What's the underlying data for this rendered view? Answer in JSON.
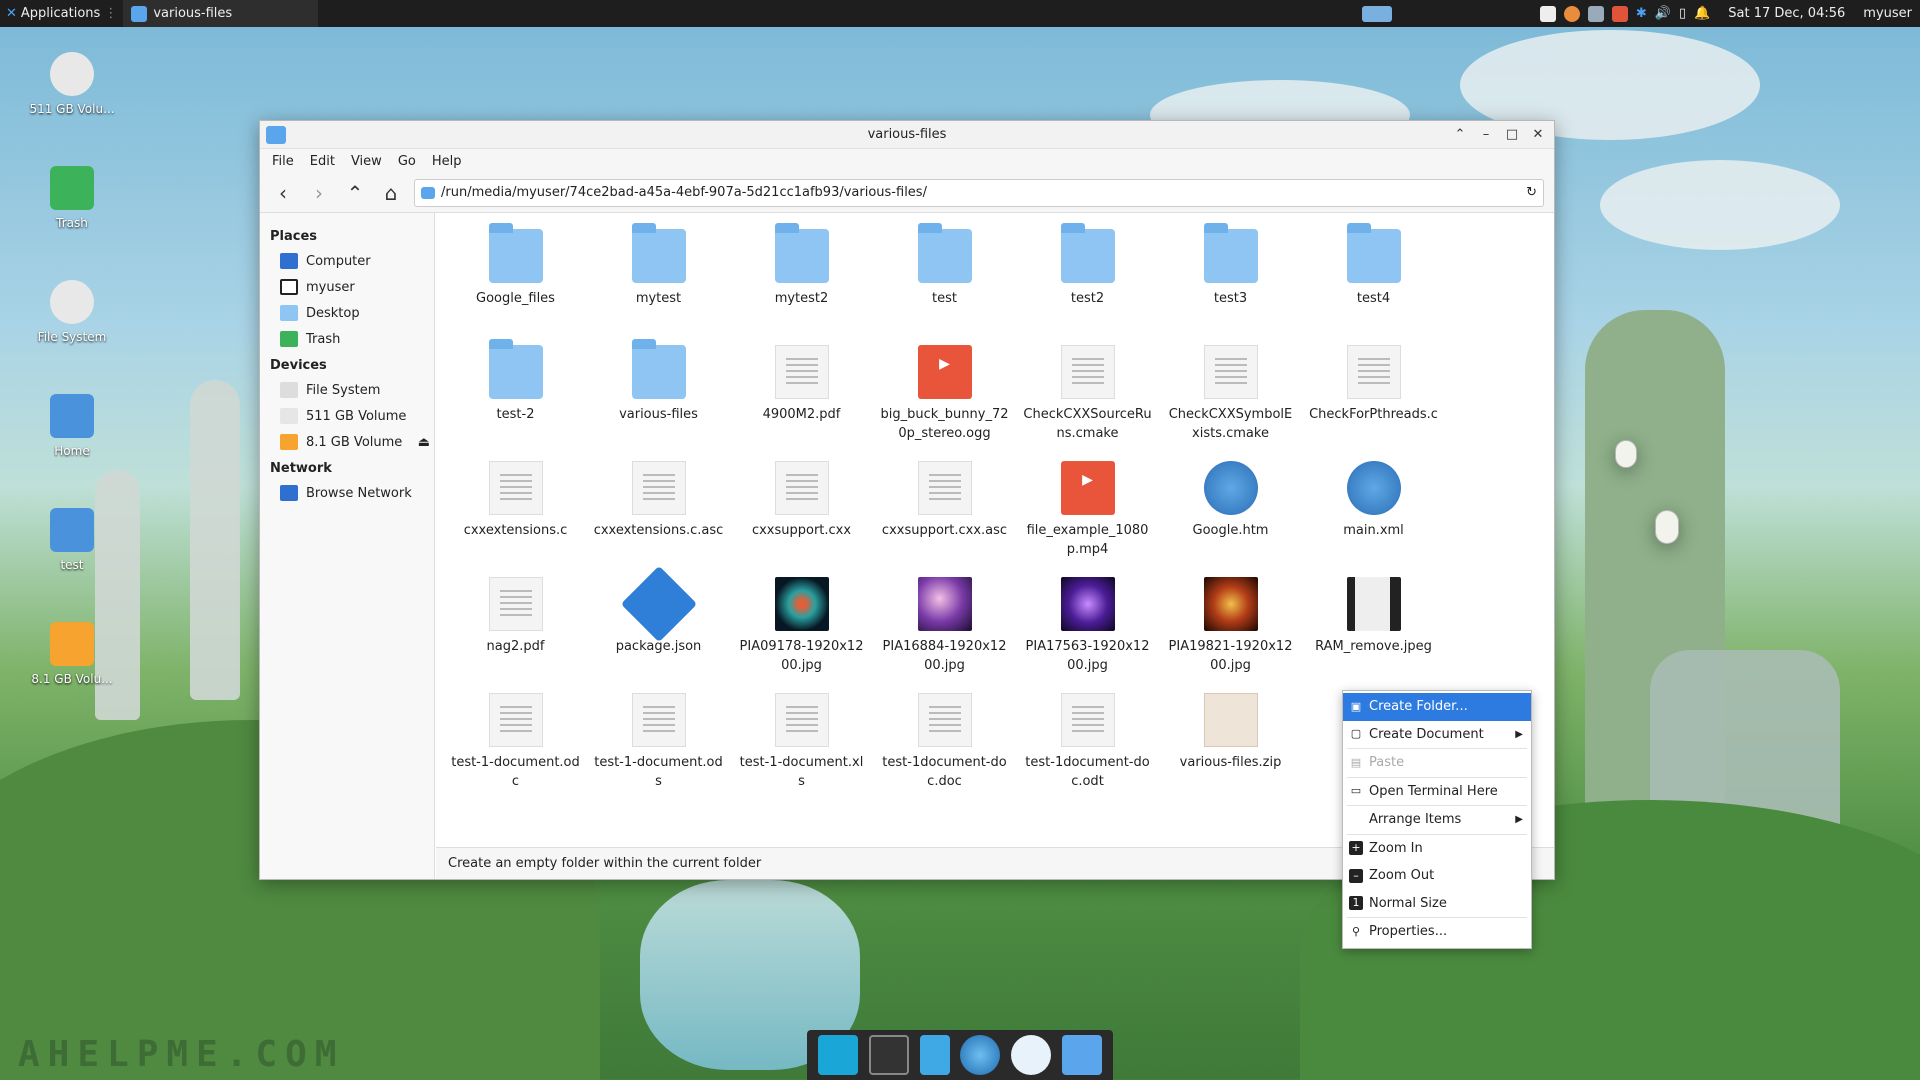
{
  "panel": {
    "applications": "Applications",
    "task_title": "various-files",
    "datetime": "Sat 17 Dec, 04:56",
    "user": "myuser"
  },
  "desktop": {
    "icons": [
      "511 GB Volu...",
      "Trash",
      "File System",
      "Home",
      "test",
      "8.1 GB Volu..."
    ],
    "watermark": "AHELPME.COM"
  },
  "window": {
    "title": "various-files",
    "path": "/run/media/myuser/74ce2bad-a45a-4ebf-907a-5d21cc1afb93/various-files/"
  },
  "menu": [
    "File",
    "Edit",
    "View",
    "Go",
    "Help"
  ],
  "sidebar": {
    "places_title": "Places",
    "places": [
      "Computer",
      "myuser",
      "Desktop",
      "Trash"
    ],
    "devices_title": "Devices",
    "devices": [
      "File System",
      "511 GB Volume",
      "8.1 GB Volume"
    ],
    "network_title": "Network",
    "network": [
      "Browse Network"
    ]
  },
  "files": [
    {
      "name": "Google_files",
      "kind": "folder"
    },
    {
      "name": "mytest",
      "kind": "folder"
    },
    {
      "name": "mytest2",
      "kind": "folder"
    },
    {
      "name": "test",
      "kind": "folder"
    },
    {
      "name": "test2",
      "kind": "folder"
    },
    {
      "name": "test3",
      "kind": "folder"
    },
    {
      "name": "test4",
      "kind": "folder"
    },
    {
      "name": "test-2",
      "kind": "folder"
    },
    {
      "name": "various-files",
      "kind": "folder"
    },
    {
      "name": "4900M2.pdf",
      "kind": "doc"
    },
    {
      "name": "big_buck_bunny_720p_stereo.ogg",
      "kind": "video"
    },
    {
      "name": "CheckCXXSourceRuns.cmake",
      "kind": "doc"
    },
    {
      "name": "CheckCXXSymbolExists.cmake",
      "kind": "doc"
    },
    {
      "name": "CheckForPthreads.c",
      "kind": "doc"
    },
    {
      "name": "cxxextensions.c",
      "kind": "doc"
    },
    {
      "name": "cxxextensions.c.asc",
      "kind": "doc"
    },
    {
      "name": "cxxsupport.cxx",
      "kind": "doc"
    },
    {
      "name": "cxxsupport.cxx.asc",
      "kind": "doc"
    },
    {
      "name": "file_example_1080p.mp4",
      "kind": "video"
    },
    {
      "name": "Google.htm",
      "kind": "globe"
    },
    {
      "name": "main.xml",
      "kind": "globe"
    },
    {
      "name": "nag2.pdf",
      "kind": "doc"
    },
    {
      "name": "package.json",
      "kind": "json"
    },
    {
      "name": "PIA09178-1920x1200.jpg",
      "kind": "img1"
    },
    {
      "name": "PIA16884-1920x1200.jpg",
      "kind": "img2"
    },
    {
      "name": "PIA17563-1920x1200.jpg",
      "kind": "img3"
    },
    {
      "name": "PIA19821-1920x1200.jpg",
      "kind": "img4"
    },
    {
      "name": "RAM_remove.jpeg",
      "kind": "img5"
    },
    {
      "name": "test-1-document.odc",
      "kind": "doc"
    },
    {
      "name": "test-1-document.ods",
      "kind": "doc"
    },
    {
      "name": "test-1-document.xls",
      "kind": "doc"
    },
    {
      "name": "test-1document-doc.doc",
      "kind": "doc"
    },
    {
      "name": "test-1document-doc.odt",
      "kind": "doc"
    },
    {
      "name": "various-files.zip",
      "kind": "zip"
    }
  ],
  "status": "Create an empty folder within the current folder",
  "context_menu": [
    "Create Folder...",
    "Create Document",
    "Paste",
    "Open Terminal Here",
    "Arrange Items",
    "Zoom In",
    "Zoom Out",
    "Normal Size",
    "Properties..."
  ],
  "colors": {
    "accent": "#2d7be0",
    "folder": "#8ec5f2"
  }
}
